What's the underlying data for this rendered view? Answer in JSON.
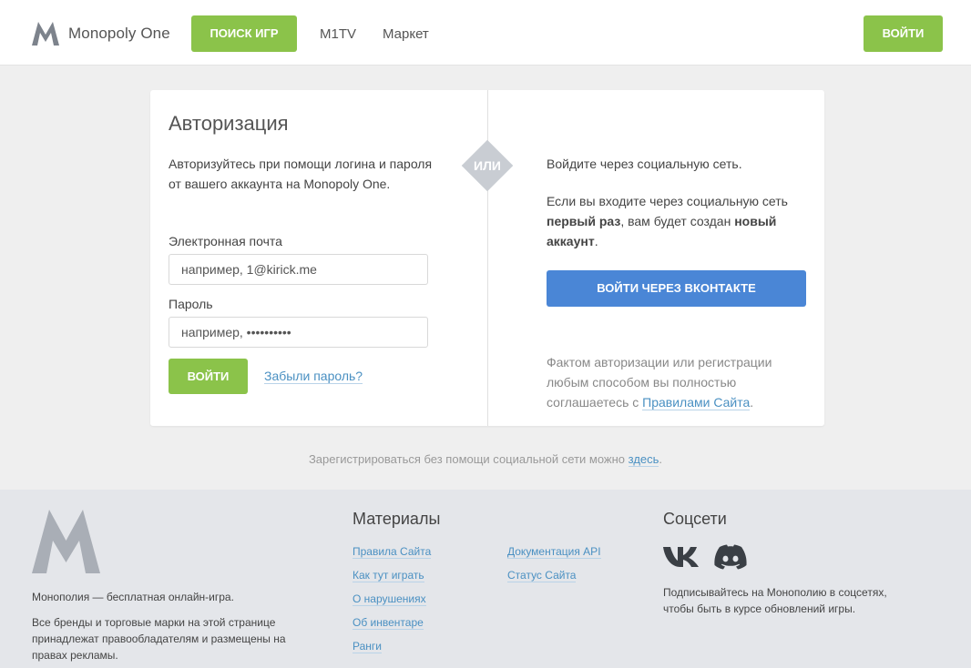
{
  "header": {
    "logo_text": "Monopoly One",
    "search_games": "ПОИСК ИГР",
    "nav_m1tv": "M1TV",
    "nav_market": "Маркет",
    "login": "ВОЙТИ"
  },
  "auth": {
    "title": "Авторизация",
    "intro": "Авторизуйтесь при помощи логина и пароля от вашего аккаунта на Monopoly One.",
    "email_label": "Электронная почта",
    "email_placeholder": "например, 1@kirick.me",
    "password_label": "Пароль",
    "password_placeholder": "например, ••••••••••",
    "login_button": "ВОЙТИ",
    "forgot_link": "Забыли пароль?",
    "or_text": "ИЛИ"
  },
  "social": {
    "intro": "Войдите через социальную сеть.",
    "first_time_1": "Если вы входите через социальную сеть ",
    "first_time_bold1": "первый раз",
    "first_time_2": ", вам будет создан ",
    "first_time_bold2": "новый аккаунт",
    "first_time_3": ".",
    "vk_button": "ВОЙТИ ЧЕРЕЗ ВКОНТАКТЕ",
    "rules_note": "Фактом авторизации или регистрации любым способом вы полностью соглашаетесь с ",
    "rules_link": "Правилами Сайта",
    "rules_end": "."
  },
  "register": {
    "text": "Зарегистрироваться без помощи социальной сети можно ",
    "link": "здесь",
    "end": "."
  },
  "footer": {
    "about": "Монополия — бесплатная онлайн-игра.",
    "disclaimer": "Все бренды и торговые марки на этой странице принадлежат правообладателям и размещены на правах рекламы.",
    "materials_title": "Материалы",
    "materials_col1": [
      "Правила Сайта",
      "Как тут играть",
      "О нарушениях",
      "Об инвентаре",
      "Ранги"
    ],
    "materials_col2": [
      "Документация API",
      "Статус Сайта"
    ],
    "social_title": "Соцсети",
    "social_icons": [
      "vk-icon",
      "discord-icon"
    ],
    "social_text": "Подписывайтесь на Монополию в соцсетях, чтобы быть в курсе обновлений игры."
  },
  "colors": {
    "accent_green": "#8bc34a",
    "vk_blue": "#4a86d6",
    "link_blue": "#4a90c2",
    "logo_gray": "#a9aeb6"
  }
}
